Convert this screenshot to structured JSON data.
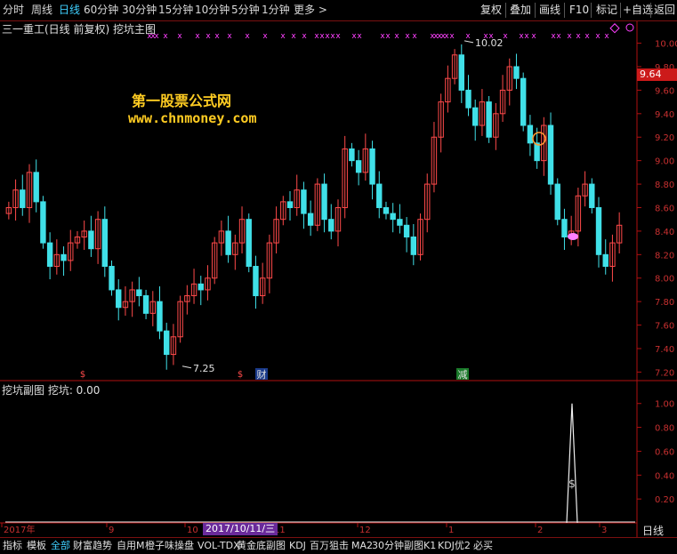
{
  "toolbar": {
    "periods": [
      "分时",
      "周线",
      "日线",
      "60分钟",
      "30分钟",
      "15分钟",
      "10分钟",
      "5分钟",
      "1分钟",
      "更多 >"
    ],
    "active_period": "日线",
    "buttons": [
      "复权",
      "叠加",
      "画线",
      "F10",
      "标记",
      "+自选",
      "返回"
    ]
  },
  "main": {
    "title": "三一重工(日线 前复权) 挖坑主图",
    "watermark_line1": "第一股票公式网",
    "watermark_line2": "www.chnmoney.com",
    "current_price_tag": "9.64",
    "high_label": "10.02",
    "low_label": "7.25",
    "event_labels": [
      "财",
      "减"
    ]
  },
  "sub": {
    "title": "挖坑副图  挖坑: 0.00"
  },
  "x_axis": {
    "labels": [
      "2017年",
      "9",
      "10",
      "11",
      "12",
      "1",
      "2",
      "3"
    ],
    "cursor_date": "2017/10/11/三",
    "period_label": "日线"
  },
  "bottom_tabs": [
    "指标",
    "模板",
    "全部",
    "财富趋势",
    "自用M",
    "橙子味操盘",
    "VOL-TDX",
    "黄金底副图",
    "KDJ",
    "百万狙击",
    "MA2",
    "30分钟副图",
    "K1",
    "KDJ优2",
    "必买"
  ],
  "active_tab": "全部",
  "colors": {
    "up": "#ff4a4a",
    "down": "#40e0e8",
    "axis": "#b01010",
    "signal": "#ff40ff",
    "text": "#e0e0e0"
  },
  "chart_data": [
    {
      "type": "candlestick",
      "title": "三一重工(日线 前复权) 挖坑主图",
      "ylim": [
        7.15,
        10.08
      ],
      "yticks": [
        7.2,
        7.4,
        7.6,
        7.8,
        8.0,
        8.2,
        8.4,
        8.6,
        8.8,
        9.0,
        9.2,
        9.4,
        9.6,
        9.8,
        10.0
      ],
      "high": 10.02,
      "low": 7.25,
      "last": 9.64,
      "close_series_approx": [
        8.6,
        8.75,
        8.6,
        8.9,
        8.65,
        8.3,
        8.1,
        8.2,
        8.15,
        8.3,
        8.35,
        8.4,
        8.25,
        8.5,
        8.1,
        7.9,
        7.75,
        7.8,
        7.9,
        7.85,
        7.7,
        7.8,
        7.55,
        7.35,
        7.5,
        7.8,
        7.85,
        7.95,
        7.9,
        8.0,
        8.3,
        8.4,
        8.2,
        8.3,
        8.5,
        8.1,
        7.85,
        8.0,
        8.3,
        8.5,
        8.65,
        8.6,
        8.75,
        8.55,
        8.45,
        8.8,
        8.5,
        8.4,
        8.6,
        9.1,
        9.0,
        8.9,
        9.1,
        8.8,
        8.6,
        8.55,
        8.5,
        8.45,
        8.35,
        8.2,
        8.5,
        8.8,
        9.2,
        9.5,
        9.7,
        9.9,
        9.6,
        9.45,
        9.3,
        9.5,
        9.2,
        9.4,
        9.6,
        9.8,
        9.7,
        9.3,
        9.15,
        9.0,
        9.3,
        8.8,
        8.5,
        8.35,
        8.4,
        8.7,
        8.8,
        8.6,
        8.2,
        8.1,
        8.3,
        8.45
      ],
      "signals": "pink x markers along top row"
    },
    {
      "type": "line",
      "title": "挖坑副图",
      "series": [
        {
          "name": "挖坑",
          "last": 0.0
        }
      ],
      "ylim": [
        0,
        1.08
      ],
      "yticks": [
        0.2,
        0.4,
        0.6,
        0.8,
        1.0
      ],
      "spike": {
        "value": 1.0
      }
    }
  ]
}
